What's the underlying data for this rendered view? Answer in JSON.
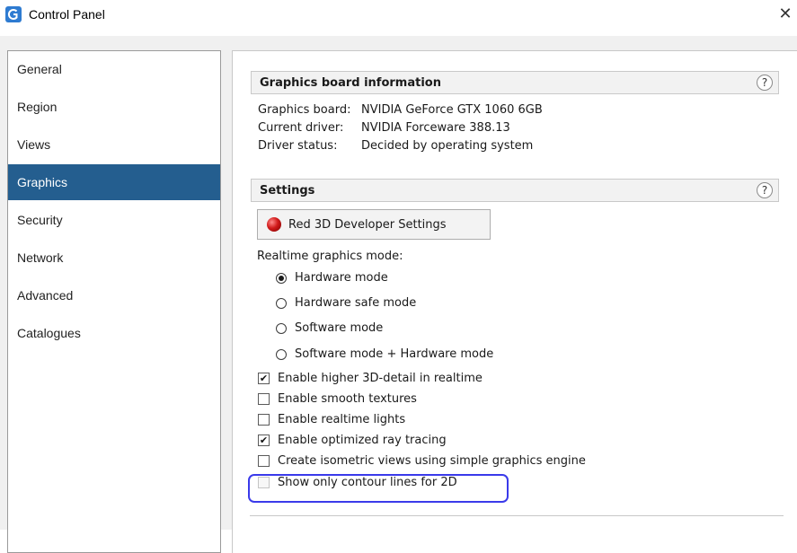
{
  "window": {
    "title": "Control Panel",
    "close_label": "✕",
    "icon": "control-panel-app-icon"
  },
  "sidebar": {
    "items": [
      {
        "label": "General",
        "selected": false
      },
      {
        "label": "Region",
        "selected": false
      },
      {
        "label": "Views",
        "selected": false
      },
      {
        "label": "Graphics",
        "selected": true
      },
      {
        "label": "Security",
        "selected": false
      },
      {
        "label": "Network",
        "selected": false
      },
      {
        "label": "Advanced",
        "selected": false
      },
      {
        "label": "Catalogues",
        "selected": false
      }
    ]
  },
  "graphics_info": {
    "header": "Graphics board information",
    "help": "?",
    "rows": [
      {
        "label": "Graphics board:",
        "value": "NVIDIA GeForce GTX 1060 6GB"
      },
      {
        "label": "Current driver:",
        "value": "NVIDIA Forceware 388.13"
      },
      {
        "label": "Driver status:",
        "value": "Decided by operating system"
      }
    ]
  },
  "settings": {
    "header": "Settings",
    "help": "?",
    "dev_button": "Red 3D Developer Settings",
    "mode_label": "Realtime graphics mode:",
    "modes": [
      {
        "label": "Hardware mode",
        "selected": true
      },
      {
        "label": "Hardware safe mode",
        "selected": false
      },
      {
        "label": "Software mode",
        "selected": false
      },
      {
        "label": "Software mode + Hardware mode",
        "selected": false
      }
    ],
    "checkboxes": [
      {
        "label": "Enable higher 3D-detail in realtime",
        "checked": true,
        "enabled": true
      },
      {
        "label": "Enable smooth textures",
        "checked": false,
        "enabled": true
      },
      {
        "label": "Enable realtime lights",
        "checked": false,
        "enabled": true
      },
      {
        "label": "Enable optimized ray tracing",
        "checked": true,
        "enabled": true
      },
      {
        "label": "Create isometric views using simple graphics engine",
        "checked": false,
        "enabled": true
      },
      {
        "label": "Show only contour lines for 2D",
        "checked": false,
        "enabled": false
      }
    ]
  },
  "colors": {
    "selected_bg": "#245e8f",
    "highlight": "#3a3aea",
    "window_bg": "#f0f0f0"
  }
}
